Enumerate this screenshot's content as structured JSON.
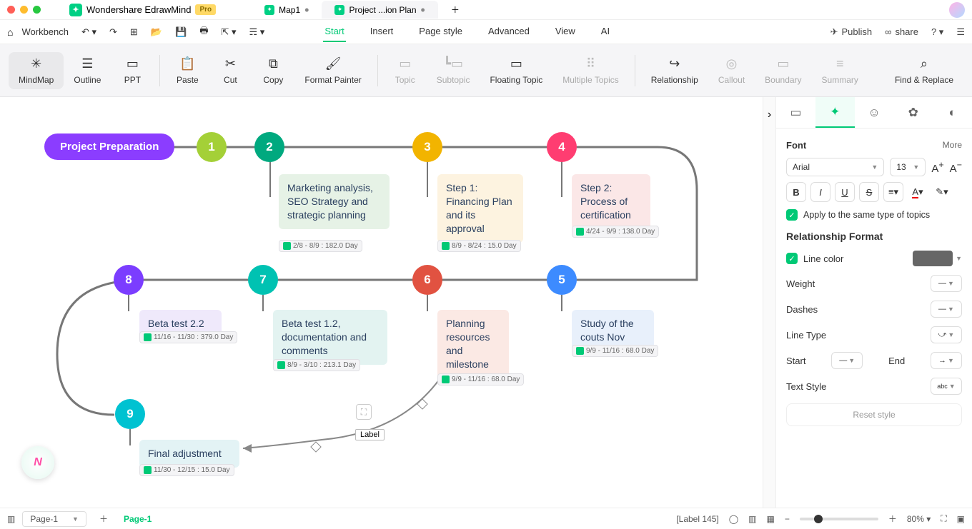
{
  "titlebar": {
    "appName": "Wondershare EdrawMind",
    "badge": "Pro",
    "tabs": [
      {
        "label": "Map1",
        "dirty": true,
        "active": false
      },
      {
        "label": "Project ...ion Plan",
        "dirty": true,
        "active": true
      }
    ]
  },
  "menubar": {
    "workbench": "Workbench",
    "menus": [
      "Start",
      "Insert",
      "Page style",
      "Advanced",
      "View",
      "AI"
    ],
    "activeMenu": "Start",
    "publish": "Publish",
    "share": "share"
  },
  "toolbar": {
    "mindmap": "MindMap",
    "outline": "Outline",
    "ppt": "PPT",
    "paste": "Paste",
    "cut": "Cut",
    "copy": "Copy",
    "formatPainter": "Format Painter",
    "topic": "Topic",
    "subtopic": "Subtopic",
    "floatingTopic": "Floating Topic",
    "multipleTopics": "Multiple Topics",
    "relationship": "Relationship",
    "callout": "Callout",
    "boundary": "Boundary",
    "summary": "Summary",
    "findReplace": "Find & Replace"
  },
  "canvas": {
    "root": "Project Preparation",
    "n1": "1",
    "n2": "2",
    "n3": "3",
    "n4": "4",
    "n5": "5",
    "n6": "6",
    "n7": "7",
    "n8": "8",
    "n9": "9",
    "note2": "Marketing analysis, SEO Strategy and strategic planning",
    "note3": "Step 1: Financing Plan and its approval",
    "note4": "Step 2: Process of certification",
    "note5": "Study of the couts Nov",
    "note6": "Planning resources and milestone",
    "note7": "Beta test 1.2, documentation and comments",
    "note8": "Beta test 2.2",
    "note9": "Final adjustment",
    "t2": "2/8 - 8/9 : 182.0 Day",
    "t3": "8/9 - 8/24 : 15.0 Day",
    "t4": "4/24 - 9/9 : 138.0 Day",
    "t5": "9/9 - 11/16 : 68.0 Day",
    "t6": "9/9 - 11/16 : 68.0 Day",
    "t7": "8/9 - 3/10 : 213.1 Day",
    "t8": "11/16 - 11/30 : 379.0 Day",
    "t9": "11/30 - 12/15 : 15.0 Day",
    "relLabel": "Label"
  },
  "panel": {
    "fontHeader": "Font",
    "more": "More",
    "fontFamily": "Arial",
    "fontSize": "13",
    "applyCheck": "Apply to the same type of topics",
    "relHeader": "Relationship Format",
    "lineColor": "Line color",
    "weight": "Weight",
    "dashes": "Dashes",
    "lineType": "Line Type",
    "start": "Start",
    "end": "End",
    "textStyle": "Text Style",
    "reset": "Reset style"
  },
  "statusbar": {
    "pageSel": "Page-1",
    "pageTab": "Page-1",
    "info": "[Label 145]",
    "zoom": "80%"
  }
}
